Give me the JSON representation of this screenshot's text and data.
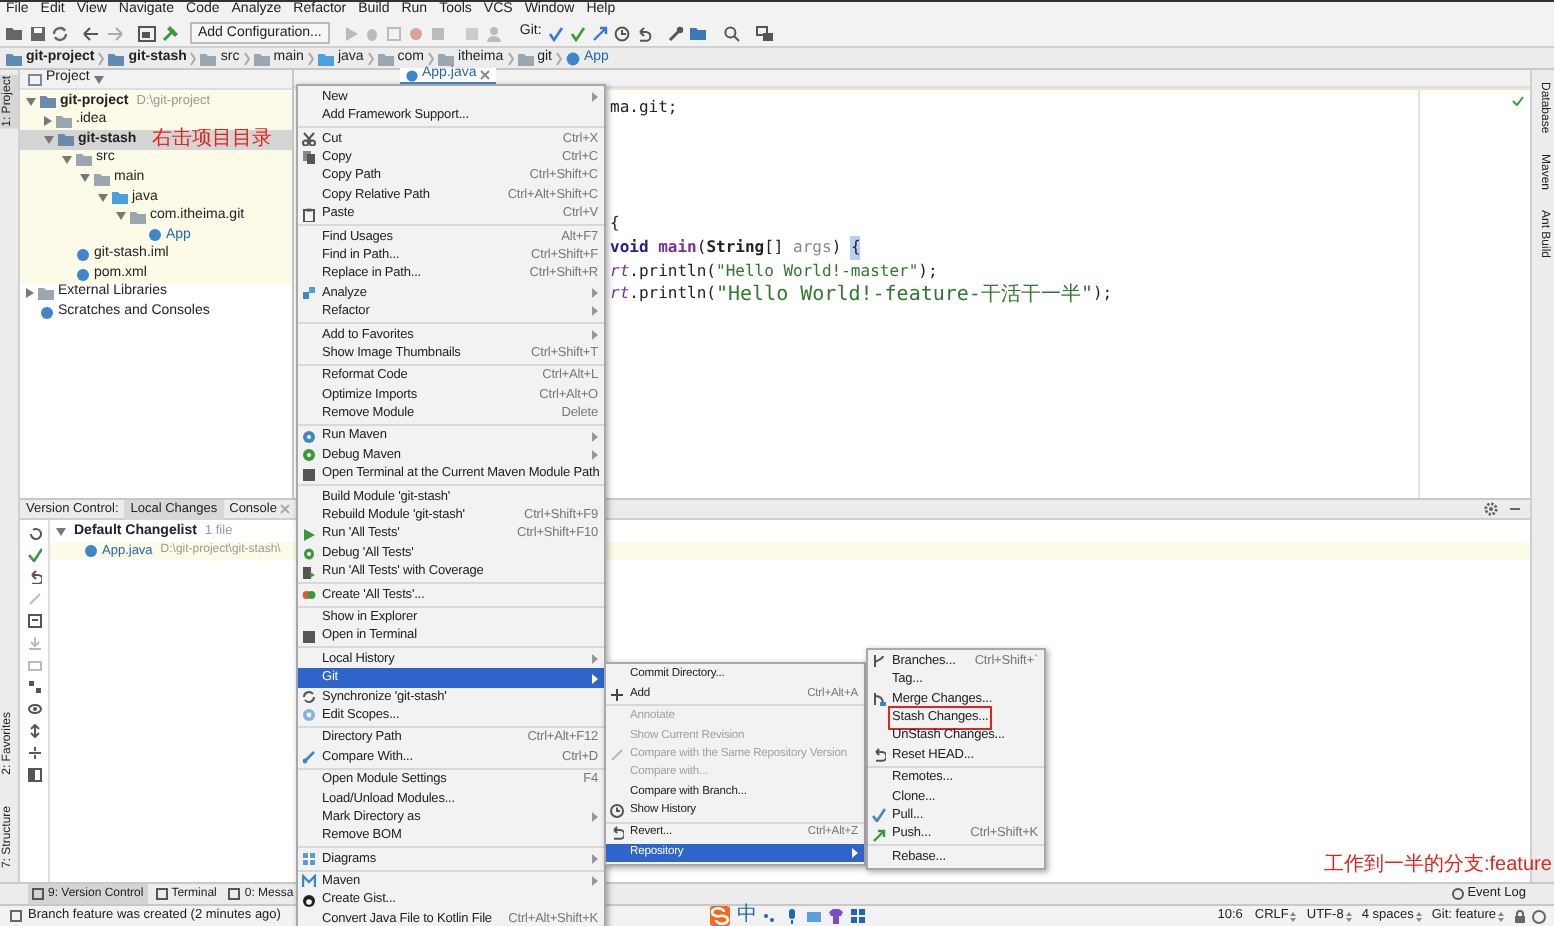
{
  "menu_bar": [
    "File",
    "Edit",
    "View",
    "Navigate",
    "Code",
    "Analyze",
    "Refactor",
    "Build",
    "Run",
    "Tools",
    "VCS",
    "Window",
    "Help"
  ],
  "toolbar": {
    "run_config": "Add Configuration...",
    "vcs_label": "Git:"
  },
  "breadcrumbs": [
    "git-project",
    "git-stash",
    "src",
    "main",
    "java",
    "com",
    "itheima",
    "git",
    "App"
  ],
  "left_strip": {
    "top": [
      {
        "label": "1: Project",
        "selected": true
      }
    ],
    "bottom": [
      {
        "label": "2: Favorites",
        "selected": false
      },
      {
        "label": "7: Structure",
        "selected": false
      }
    ]
  },
  "right_strip": [
    "Database",
    "Maven",
    "Ant Build"
  ],
  "project": {
    "title": "Project",
    "tree": [
      {
        "name": "git-project",
        "path": "D:\\git-project",
        "expanded": true,
        "selected": false,
        "children": [
          {
            "name": ".idea",
            "expanded": false,
            "selected": false
          },
          {
            "name": "git-stash",
            "note": "右击项目目录",
            "expanded": true,
            "selected": true,
            "children": [
              {
                "name": "src",
                "expanded": true,
                "selected": false,
                "children": [
                  {
                    "name": "main",
                    "expanded": true,
                    "selected": false,
                    "children": [
                      {
                        "name": "java",
                        "expanded": true,
                        "selected": false,
                        "children": [
                          {
                            "name": "com.itheima.git",
                            "expanded": true,
                            "selected": false,
                            "children": [
                              {
                                "name": "App",
                                "selected": false
                              }
                            ]
                          }
                        ]
                      }
                    ]
                  }
                ]
              },
              {
                "name": "git-stash.iml",
                "selected": false
              },
              {
                "name": "pom.xml",
                "selected": false
              }
            ]
          }
        ]
      },
      {
        "name": "External Libraries",
        "expanded": false,
        "selected": false
      },
      {
        "name": "Scratches and Consoles",
        "selected": false
      }
    ]
  },
  "editor": {
    "tab": {
      "label": "App.java"
    },
    "lines": [
      [
        {
          "kind": "plain",
          "text": "ma.git;"
        }
      ],
      [
        {
          "kind": "plain",
          "text": "{"
        }
      ],
      [
        {
          "kind": "keyword",
          "text": "void "
        },
        {
          "kind": "method",
          "text": "main"
        },
        {
          "kind": "plain",
          "text": "("
        },
        {
          "kind": "type",
          "text": "String"
        },
        {
          "kind": "plain",
          "text": "[] "
        },
        {
          "kind": "param",
          "text": "args"
        },
        {
          "kind": "plain",
          "text": ") "
        },
        {
          "kind": "brace_match",
          "text": "{"
        }
      ],
      [
        {
          "kind": "field",
          "text": "rt"
        },
        {
          "kind": "plain",
          "text": ".println("
        },
        {
          "kind": "string",
          "text": "\"Hello World!-master\""
        },
        {
          "kind": "plain",
          "text": ");"
        }
      ],
      [
        {
          "kind": "field",
          "text": "rt"
        },
        {
          "kind": "plain",
          "text": ".println("
        },
        {
          "kind": "string",
          "text": "\"Hello World!-feature-干活干一半\""
        },
        {
          "kind": "plain",
          "text": ");"
        }
      ]
    ]
  },
  "context_menu": {
    "groups": [
      [
        {
          "label": "New",
          "submenu": true,
          "selected": false
        },
        {
          "label": "Add Framework Support...",
          "selected": false
        }
      ],
      [
        {
          "label": "Cut",
          "shortcut": "Ctrl+X",
          "selected": false
        },
        {
          "label": "Copy",
          "shortcut": "Ctrl+C",
          "selected": false
        },
        {
          "label": "Copy Path",
          "shortcut": "Ctrl+Shift+C",
          "selected": false
        },
        {
          "label": "Copy Relative Path",
          "shortcut": "Ctrl+Alt+Shift+C",
          "selected": false
        },
        {
          "label": "Paste",
          "shortcut": "Ctrl+V",
          "selected": false
        }
      ],
      [
        {
          "label": "Find Usages",
          "shortcut": "Alt+F7",
          "selected": false
        },
        {
          "label": "Find in Path...",
          "shortcut": "Ctrl+Shift+F",
          "selected": false
        },
        {
          "label": "Replace in Path...",
          "shortcut": "Ctrl+Shift+R",
          "selected": false
        },
        {
          "label": "Analyze",
          "submenu": true,
          "selected": false
        },
        {
          "label": "Refactor",
          "submenu": true,
          "selected": false
        }
      ],
      [
        {
          "label": "Add to Favorites",
          "submenu": true,
          "selected": false
        },
        {
          "label": "Show Image Thumbnails",
          "shortcut": "Ctrl+Shift+T",
          "selected": false
        }
      ],
      [
        {
          "label": "Reformat Code",
          "shortcut": "Ctrl+Alt+L",
          "selected": false
        },
        {
          "label": "Optimize Imports",
          "shortcut": "Ctrl+Alt+O",
          "selected": false
        },
        {
          "label": "Remove Module",
          "shortcut": "Delete",
          "selected": false
        }
      ],
      [
        {
          "label": "Run Maven",
          "submenu": true,
          "selected": false
        },
        {
          "label": "Debug Maven",
          "submenu": true,
          "selected": false
        },
        {
          "label": "Open Terminal at the Current Maven Module Path",
          "selected": false
        }
      ],
      [
        {
          "label": "Build Module 'git-stash'",
          "selected": false
        },
        {
          "label": "Rebuild Module 'git-stash'",
          "shortcut": "Ctrl+Shift+F9",
          "selected": false
        },
        {
          "label": "Run 'All Tests'",
          "shortcut": "Ctrl+Shift+F10",
          "selected": false
        },
        {
          "label": "Debug 'All Tests'",
          "selected": false
        },
        {
          "label": "Run 'All Tests' with Coverage",
          "selected": false
        }
      ],
      [
        {
          "label": "Create 'All Tests'...",
          "selected": false
        }
      ],
      [
        {
          "label": "Show in Explorer",
          "selected": false
        },
        {
          "label": "Open in Terminal",
          "selected": false
        }
      ],
      [
        {
          "label": "Local History",
          "submenu": true,
          "selected": false
        },
        {
          "label": "Git",
          "submenu": true,
          "selected": true
        },
        {
          "label": "Synchronize 'git-stash'",
          "selected": false
        },
        {
          "label": "Edit Scopes...",
          "selected": false
        }
      ],
      [
        {
          "label": "Directory Path",
          "shortcut": "Ctrl+Alt+F12",
          "selected": false
        },
        {
          "label": "Compare With...",
          "shortcut": "Ctrl+D",
          "selected": false
        }
      ],
      [
        {
          "label": "Open Module Settings",
          "shortcut": "F4",
          "selected": false
        },
        {
          "label": "Load/Unload Modules...",
          "selected": false
        },
        {
          "label": "Mark Directory as",
          "submenu": true,
          "selected": false
        },
        {
          "label": "Remove BOM",
          "selected": false
        }
      ],
      [
        {
          "label": "Diagrams",
          "submenu": true,
          "selected": false
        }
      ],
      [
        {
          "label": "Maven",
          "submenu": true,
          "selected": false
        },
        {
          "label": "Create Gist...",
          "selected": false
        },
        {
          "label": "Convert Java File to Kotlin File",
          "shortcut": "Ctrl+Alt+Shift+K",
          "selected": false
        }
      ]
    ]
  },
  "git_menu": {
    "groups": [
      [
        {
          "label": "Commit Directory...",
          "disabled": false,
          "selected": false
        },
        {
          "label": "Add",
          "shortcut": "Ctrl+Alt+A",
          "disabled": false,
          "selected": false
        }
      ],
      [
        {
          "label": "Annotate",
          "disabled": true,
          "selected": false
        },
        {
          "label": "Show Current Revision",
          "disabled": true,
          "selected": false
        },
        {
          "label": "Compare with the Same Repository Version",
          "disabled": true,
          "selected": false
        },
        {
          "label": "Compare with...",
          "disabled": true,
          "selected": false
        },
        {
          "label": "Compare with Branch...",
          "disabled": false,
          "selected": false
        },
        {
          "label": "Show History",
          "disabled": false,
          "selected": false
        }
      ],
      [
        {
          "label": "Revert...",
          "shortcut": "Ctrl+Alt+Z",
          "disabled": false,
          "selected": false
        },
        {
          "label": "Repository",
          "submenu": true,
          "disabled": false,
          "selected": true
        }
      ]
    ]
  },
  "repository_menu": {
    "groups": [
      [
        {
          "label": "Branches...",
          "shortcut": "Ctrl+Shift+`",
          "boxed": false
        },
        {
          "label": "Tag...",
          "boxed": false
        },
        {
          "label": "Merge Changes...",
          "boxed": false
        },
        {
          "label": "Stash Changes...",
          "boxed": true
        },
        {
          "label": "UnStash Changes...",
          "boxed": false
        },
        {
          "label": "Reset HEAD...",
          "boxed": false
        }
      ],
      [
        {
          "label": "Remotes...",
          "boxed": false
        },
        {
          "label": "Clone...",
          "boxed": false
        },
        {
          "label": "Pull...",
          "boxed": false
        },
        {
          "label": "Push...",
          "shortcut": "Ctrl+Shift+K",
          "boxed": false
        }
      ],
      [
        {
          "label": "Rebase...",
          "boxed": false
        }
      ]
    ]
  },
  "bottom_panel": {
    "label": "Version Control:",
    "tabs": [
      {
        "label": "Local Changes",
        "selected": true
      },
      {
        "label": "Console",
        "selected": false
      }
    ],
    "changelist": {
      "name": "Default Changelist",
      "count": "1 file",
      "files": [
        {
          "name": "App.java",
          "path": "D:\\git-project\\git-stash\\"
        }
      ]
    }
  },
  "tool_tabs": [
    {
      "label": "9: Version Control",
      "selected": true
    },
    {
      "label": "Terminal",
      "selected": false
    },
    {
      "label": "0: Messa",
      "selected": false
    }
  ],
  "event_log": "Event Log",
  "annotation": "工作到一半的分支:feature",
  "status_bar": {
    "message": "Branch feature was created (2 minutes ago)",
    "ime": "中",
    "position": "10:6",
    "items": [
      "CRLF",
      "UTF-8",
      "4 spaces",
      "Git: feature"
    ]
  }
}
